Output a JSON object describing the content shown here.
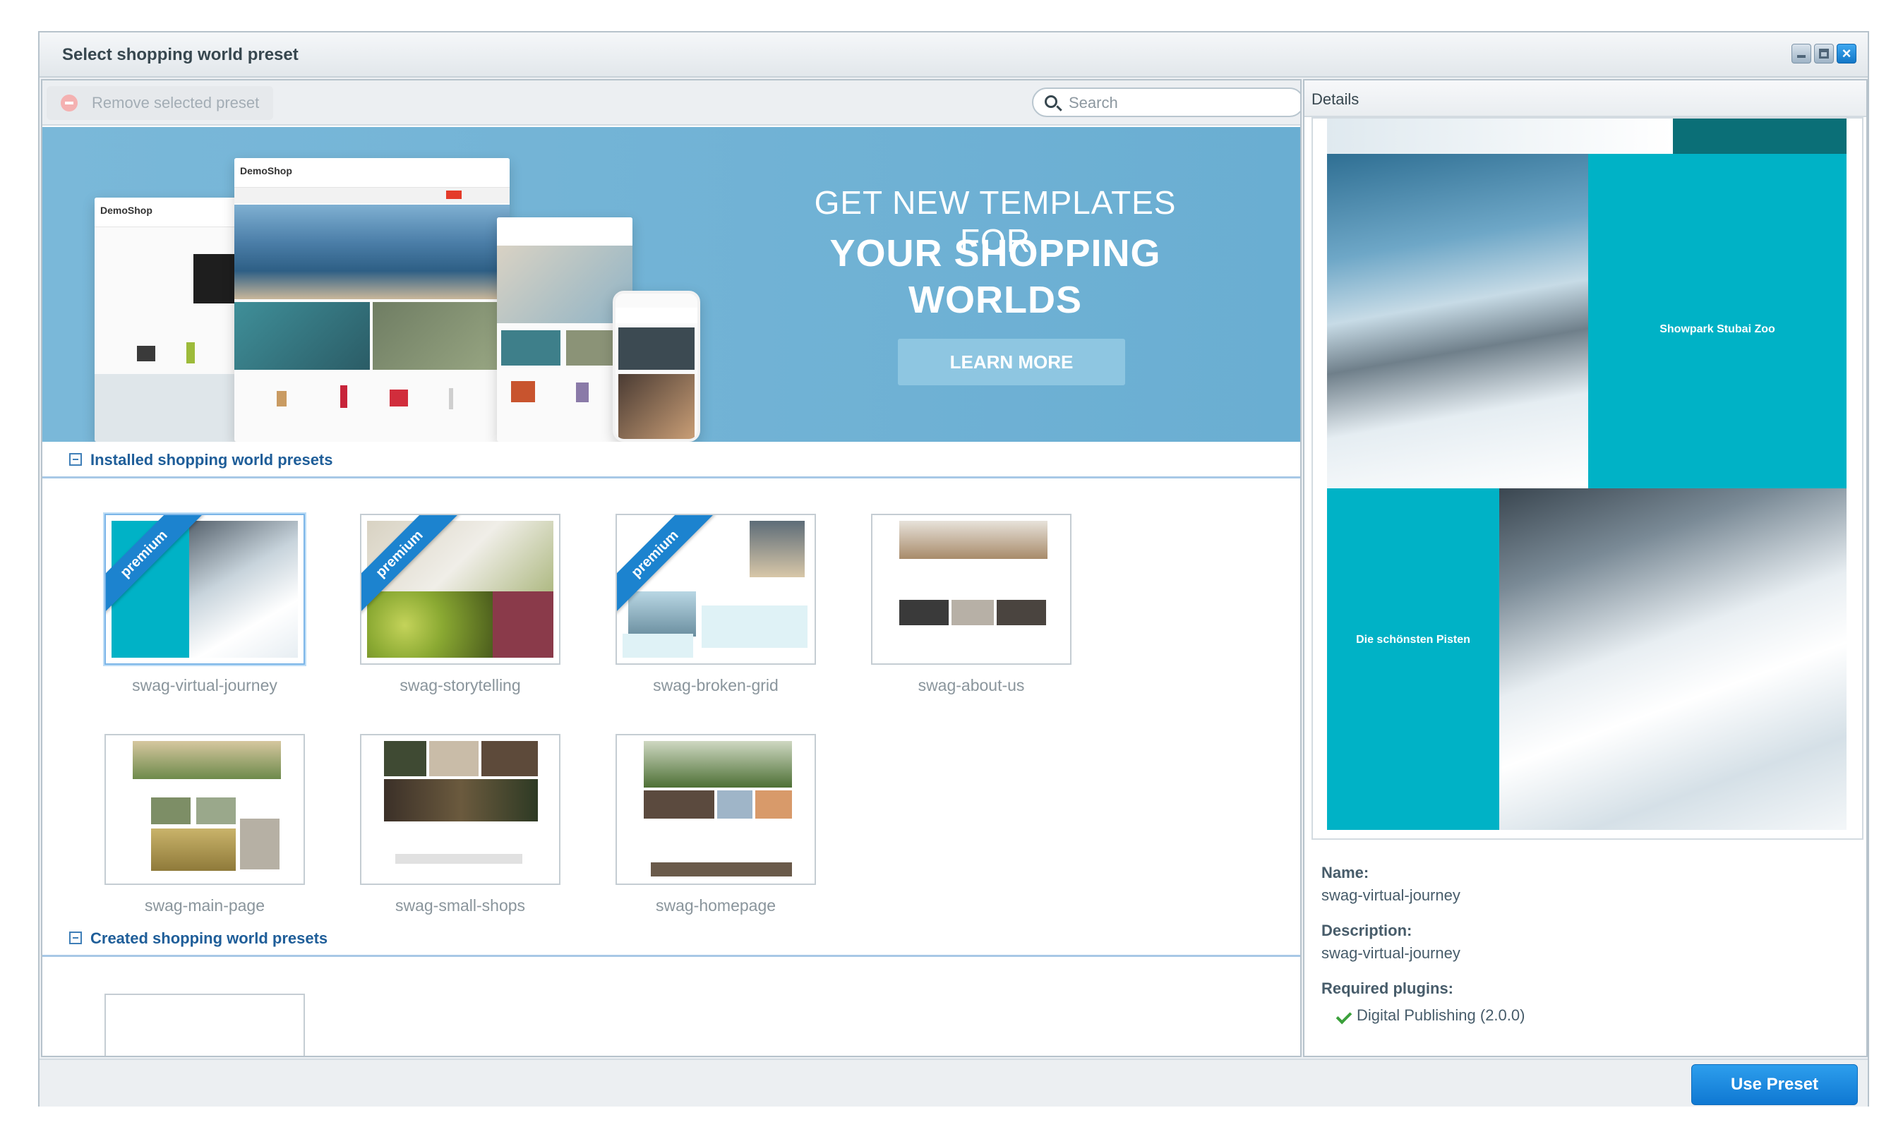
{
  "window": {
    "title": "Select shopping world preset"
  },
  "toolbar": {
    "remove_label": "Remove selected preset",
    "search_placeholder": "Search"
  },
  "banner": {
    "line1": "GET NEW TEMPLATES FOR",
    "line2": "YOUR SHOPPING",
    "line3": "WORLDS",
    "cta": "LEARN MORE",
    "mock_logo": "DemoShop"
  },
  "sections": {
    "installed": "Installed shopping world presets",
    "created": "Created shopping world presets"
  },
  "presets": [
    {
      "name": "swag-virtual-journey",
      "premium": true,
      "selected": true
    },
    {
      "name": "swag-storytelling",
      "premium": true,
      "selected": false
    },
    {
      "name": "swag-broken-grid",
      "premium": true,
      "selected": false
    },
    {
      "name": "swag-about-us",
      "premium": false,
      "selected": false
    },
    {
      "name": "swag-main-page",
      "premium": false,
      "selected": false
    },
    {
      "name": "swag-small-shops",
      "premium": false,
      "selected": false
    },
    {
      "name": "swag-homepage",
      "premium": false,
      "selected": false
    }
  ],
  "ribbon_label": "premium",
  "details": {
    "header": "Details",
    "preview_text_1": "Showpark Stubai Zoo",
    "preview_text_2": "Die schönsten Pisten",
    "name_label": "Name:",
    "name_value": "swag-virtual-journey",
    "description_label": "Description:",
    "description_value": "swag-virtual-journey",
    "plugins_label": "Required plugins:",
    "plugins": [
      "Digital Publishing (2.0.0)"
    ]
  },
  "footer": {
    "use_button": "Use Preset"
  },
  "colors": {
    "accent": "#1c83cf",
    "banner": "#72b3d6",
    "teal": "#00b2c6"
  }
}
